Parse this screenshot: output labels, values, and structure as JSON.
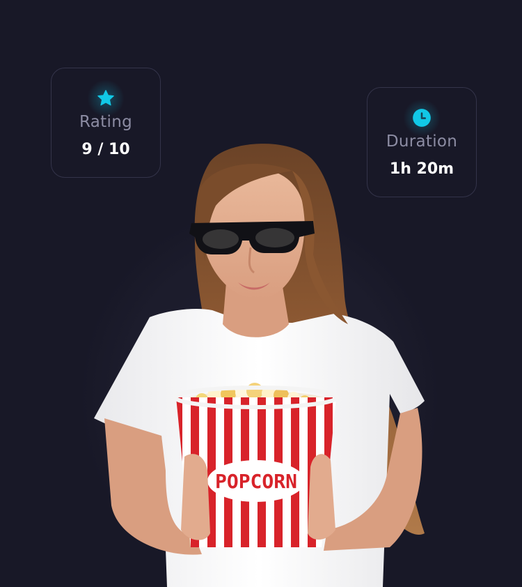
{
  "rating_card": {
    "label": "Rating",
    "value": "9 / 10",
    "icon": "star-icon"
  },
  "duration_card": {
    "label": "Duration",
    "value": "1h 20m",
    "icon": "clock-icon"
  },
  "photo": {
    "bucket_text": "POPCORN"
  },
  "colors": {
    "background": "#181827",
    "accent": "#11c8e6",
    "card_border": "#34344a",
    "label_gray": "#8c8ca3",
    "value_white": "#ffffff",
    "bucket_red": "#d8232a"
  }
}
